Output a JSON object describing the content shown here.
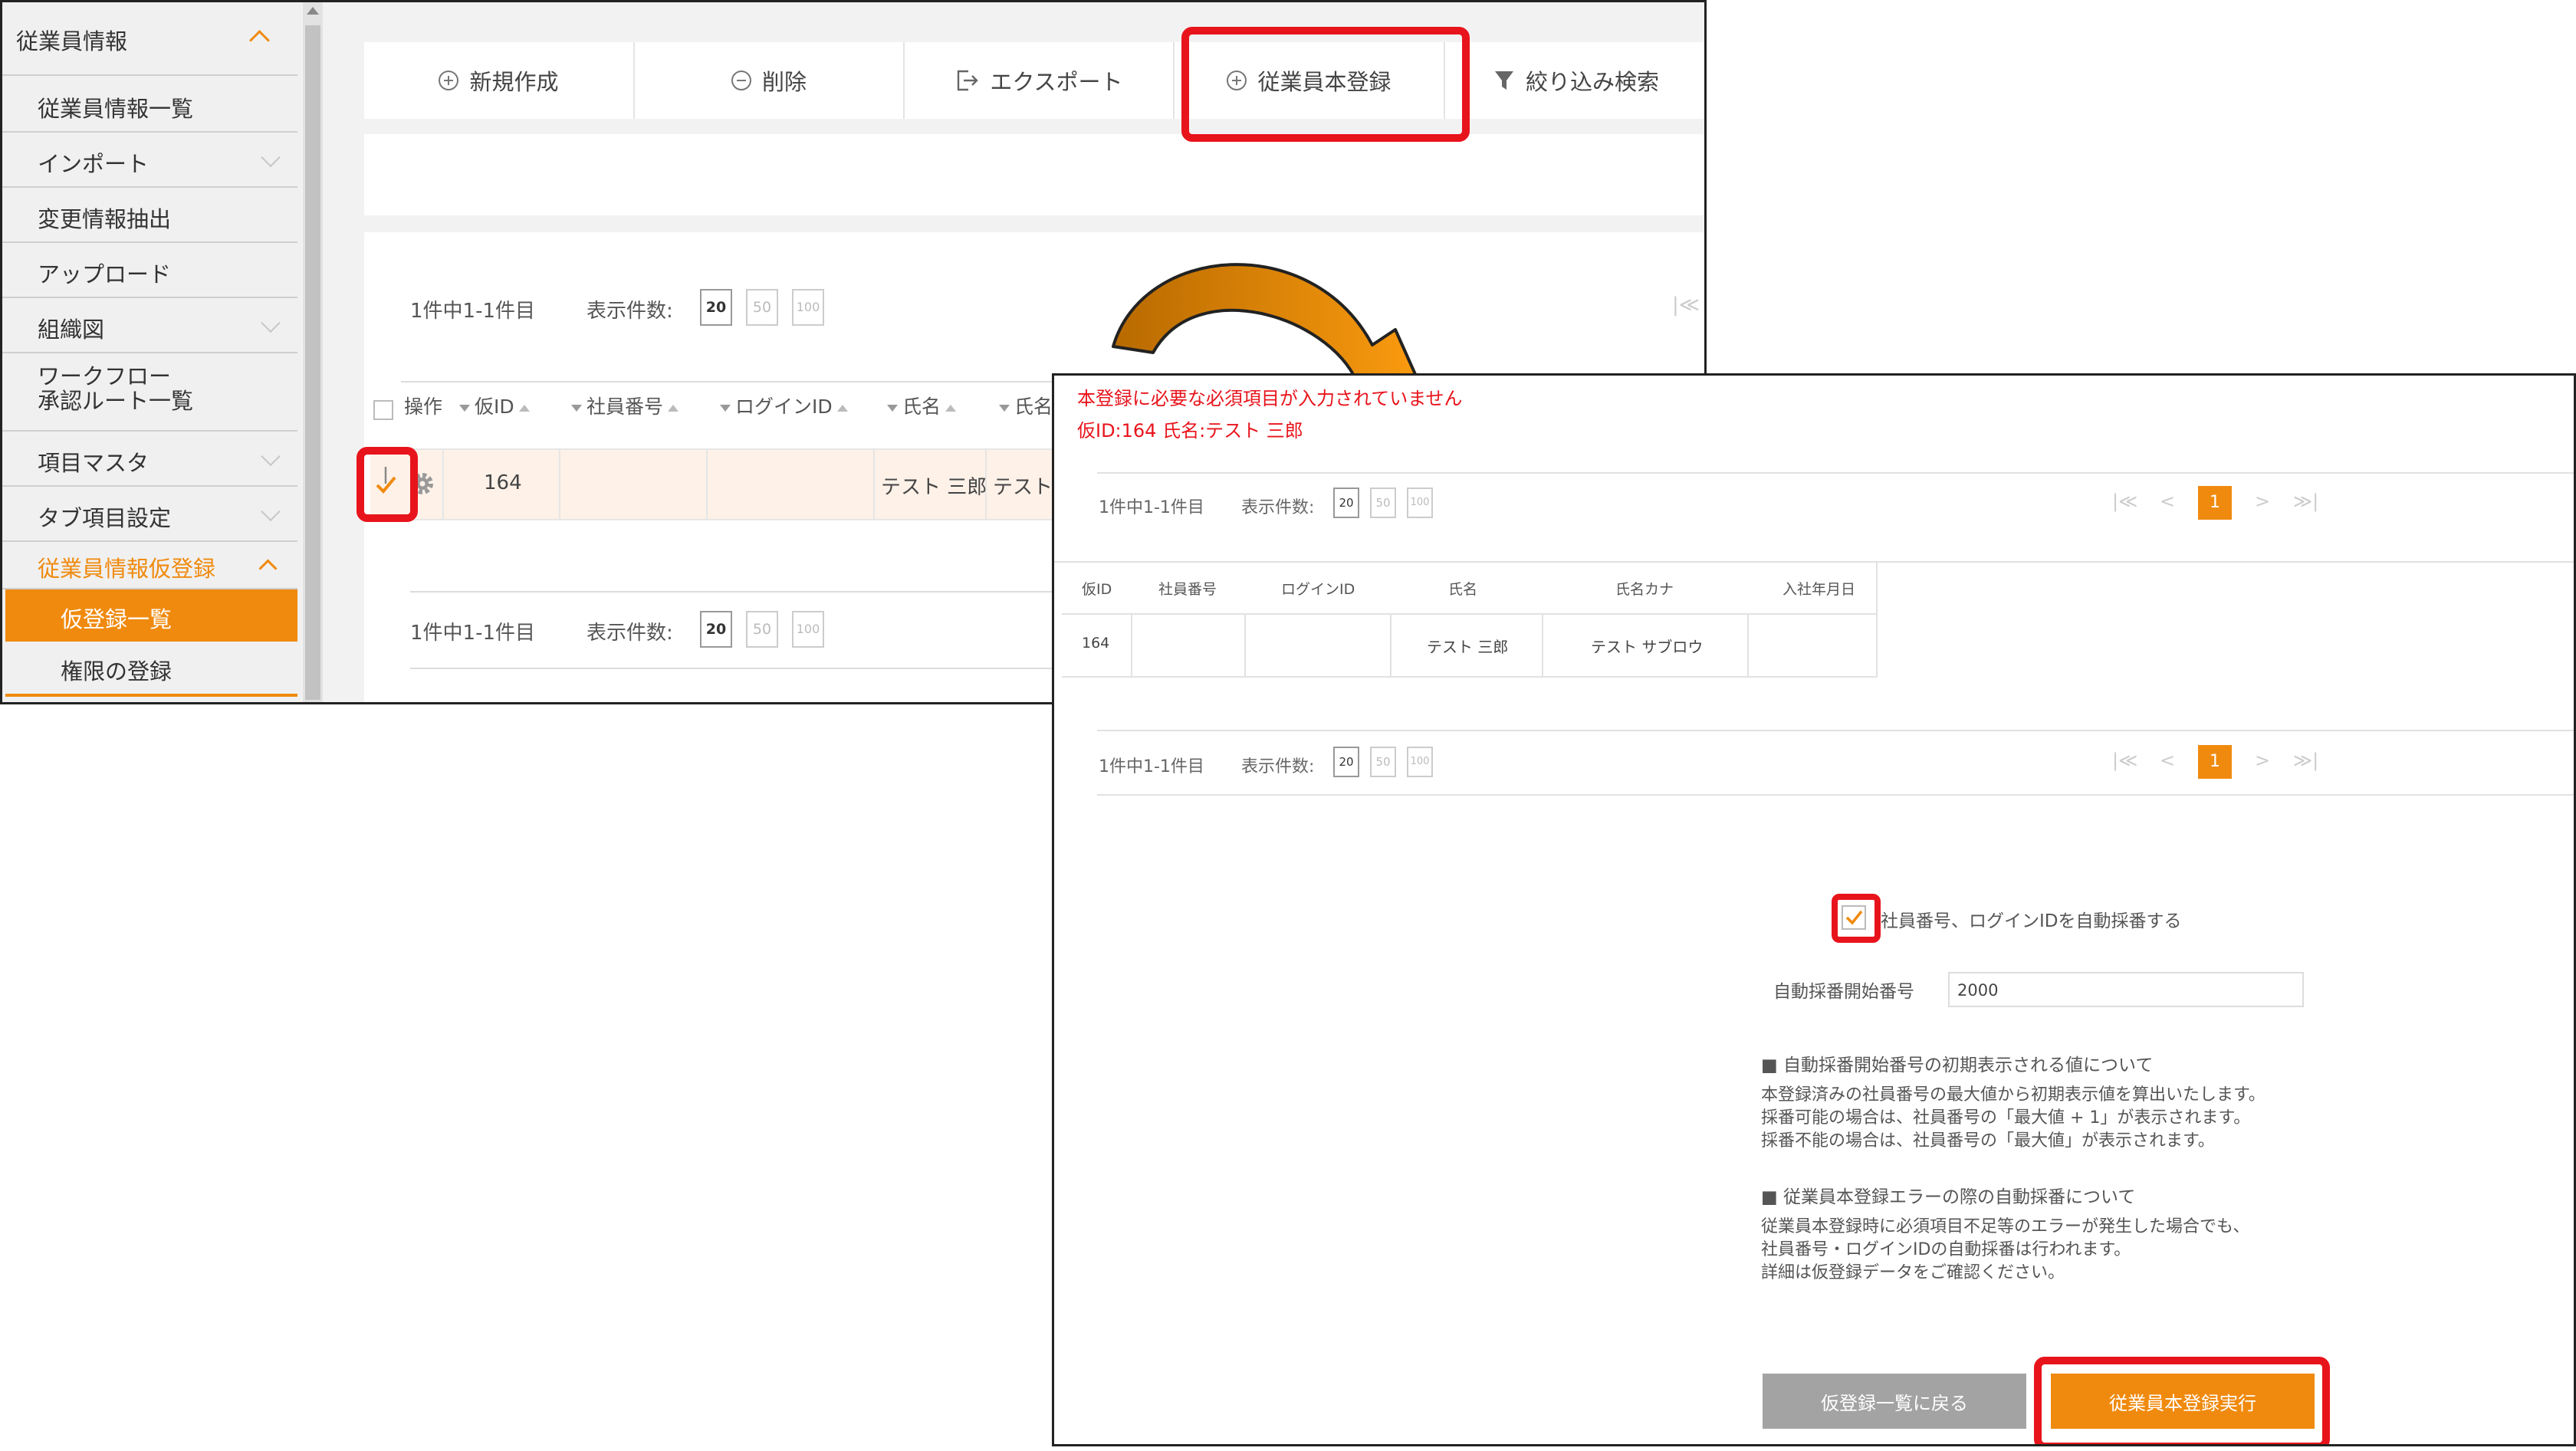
{
  "sidebar": {
    "header": "従業員情報",
    "items": [
      {
        "label": "従業員情報一覧",
        "chevron": false
      },
      {
        "label": "インポート",
        "chevron": true
      },
      {
        "label": "変更情報抽出",
        "chevron": false
      },
      {
        "label": "アップロード",
        "chevron": false
      },
      {
        "label": "組織図",
        "chevron": true
      },
      {
        "label": "ワークフロー\n承認ルート一覧",
        "chevron": false
      },
      {
        "label": "項目マスタ",
        "chevron": true
      },
      {
        "label": "タブ項目設定",
        "chevron": true
      },
      {
        "label": "従業員情報仮登録",
        "chevron": "up"
      }
    ],
    "sub_items": [
      {
        "label": "仮登録一覧",
        "active": true
      },
      {
        "label": "権限の登録",
        "active": false
      }
    ]
  },
  "toolbar": {
    "new_label": "新規作成",
    "delete_label": "削除",
    "export_label": "エクスポート",
    "register_label": "従業員本登録",
    "filter_label": "絞り込み検索"
  },
  "list": {
    "count_text": "1件中1-1件目",
    "page_size_label": "表示件数:",
    "page_sizes": [
      "20",
      "50",
      "100"
    ],
    "headers": [
      "操作",
      "仮ID",
      "社員番号",
      "ログインID",
      "氏名",
      "氏名"
    ],
    "row": {
      "temp_id": "164",
      "name": "テスト 三郎",
      "name_kana": "テスト"
    }
  },
  "dialog": {
    "error_line1": "本登録に必要な必須項目が入力されていません",
    "error_line2": "仮ID:164 氏名:テスト 三郎",
    "count_text": "1件中1-1件目",
    "page_size_label": "表示件数:",
    "page_sizes": [
      "20",
      "50",
      "100"
    ],
    "current_page": "1",
    "headers": [
      "仮ID",
      "社員番号",
      "ログインID",
      "氏名",
      "氏名カナ",
      "入社年月日"
    ],
    "row": {
      "temp_id": "164",
      "employee_no": "",
      "login_id": "",
      "name": "テスト 三郎",
      "name_kana": "テスト サブロウ",
      "hire_date": ""
    },
    "auto_number_checkbox_label": "社員番号、ログインIDを自動採番する",
    "auto_number_start_label": "自動採番開始番号",
    "auto_number_start_value": "2000",
    "note1_title": "■ 自動採番開始番号の初期表示される値について",
    "note1_body": "本登録済みの社員番号の最大値から初期表示値を算出いたします。\n採番可能の場合は、社員番号の「最大値 + 1」が表示されます。\n採番不能の場合は、社員番号の「最大値」が表示されます。",
    "note2_title": "■ 従業員本登録エラーの際の自動採番について",
    "note2_body": "従業員本登録時に必須項目不足等のエラーが発生した場合でも、\n社員番号・ログインIDの自動採番は行われます。\n詳細は仮登録データをご確認ください。",
    "back_button": "仮登録一覧に戻る",
    "execute_button": "従業員本登録実行"
  },
  "colors": {
    "accent": "#f08a0e",
    "highlight": "#e8141c",
    "error_text": "#e8141c"
  }
}
